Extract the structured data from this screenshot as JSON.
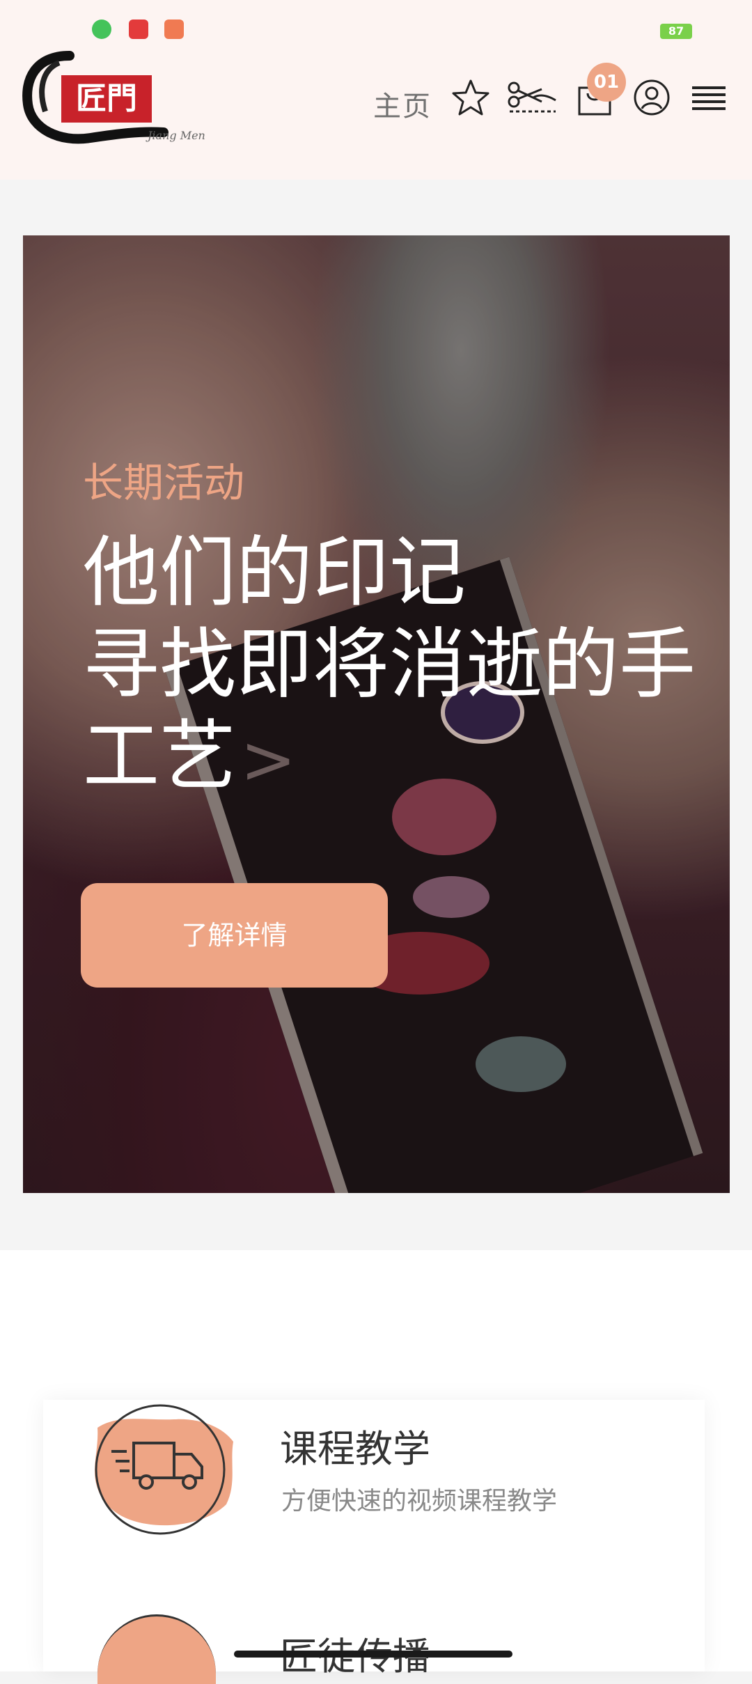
{
  "status_bar": {
    "battery": "87"
  },
  "header": {
    "logo_text": "匠門",
    "logo_script": "Jiang Men",
    "nav_home": "主页",
    "cart_count": "01"
  },
  "hero": {
    "tag": "长期活动",
    "title_line1": "他们的印记",
    "title_line2": "寻找即将消逝的手",
    "title_line3": "工艺",
    "arrow": ">",
    "button_label": "了解详情"
  },
  "features": [
    {
      "title": "课程教学",
      "subtitle": "方便快速的视频课程教学",
      "icon": "delivery-truck-icon"
    },
    {
      "title": "匠徒传播",
      "icon": "half-circle-icon"
    }
  ],
  "colors": {
    "accent": "#eea585",
    "header_bg": "#fdf4f2",
    "text_dark": "#333333",
    "text_muted": "#888888"
  }
}
